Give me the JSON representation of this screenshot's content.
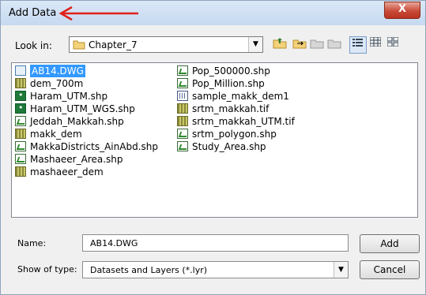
{
  "dialog": {
    "title": "Add Data",
    "close_label": "X"
  },
  "lookin": {
    "label": "Look in:",
    "folder": "Chapter_7"
  },
  "toolbar": {
    "icons": [
      "up-folder-icon",
      "connect-folder-icon",
      "disconnect-folder-icon",
      "new-folder-icon",
      "list-view-icon",
      "details-view-icon",
      "thumbnails-view-icon"
    ]
  },
  "files": {
    "column1": [
      {
        "name": "AB14.DWG",
        "icon": "dwg",
        "selected": true
      },
      {
        "name": "dem_700m",
        "icon": "raster"
      },
      {
        "name": "Haram_UTM.shp",
        "icon": "point"
      },
      {
        "name": "Haram_UTM_WGS.shp",
        "icon": "point"
      },
      {
        "name": "Jeddah_Makkah.shp",
        "icon": "shapefile"
      },
      {
        "name": "makk_dem",
        "icon": "raster"
      },
      {
        "name": "MakkaDistricts_AinAbd.shp",
        "icon": "shapefile"
      },
      {
        "name": "Mashaeer_Area.shp",
        "icon": "shapefile"
      },
      {
        "name": "mashaeer_dem",
        "icon": "raster"
      }
    ],
    "column2": [
      {
        "name": "Pop_500000.shp",
        "icon": "shapefile"
      },
      {
        "name": "Pop_Million.shp",
        "icon": "shapefile"
      },
      {
        "name": "sample_makk_dem1",
        "icon": "grid"
      },
      {
        "name": "srtm_makkah.tif",
        "icon": "raster"
      },
      {
        "name": "srtm_makkah_UTM.tif",
        "icon": "raster"
      },
      {
        "name": "srtm_polygon.shp",
        "icon": "shapefile"
      },
      {
        "name": "Study_Area.shp",
        "icon": "shapefile"
      }
    ]
  },
  "name_field": {
    "label": "Name:",
    "value": "AB14.DWG"
  },
  "type_field": {
    "label": "Show of type:",
    "value": "Datasets and Layers (*.lyr)"
  },
  "buttons": {
    "add": "Add",
    "cancel": "Cancel"
  },
  "colors": {
    "selection": "#3399ff",
    "annotation_arrow": "#e0201a",
    "close_button": "#c94a38"
  }
}
